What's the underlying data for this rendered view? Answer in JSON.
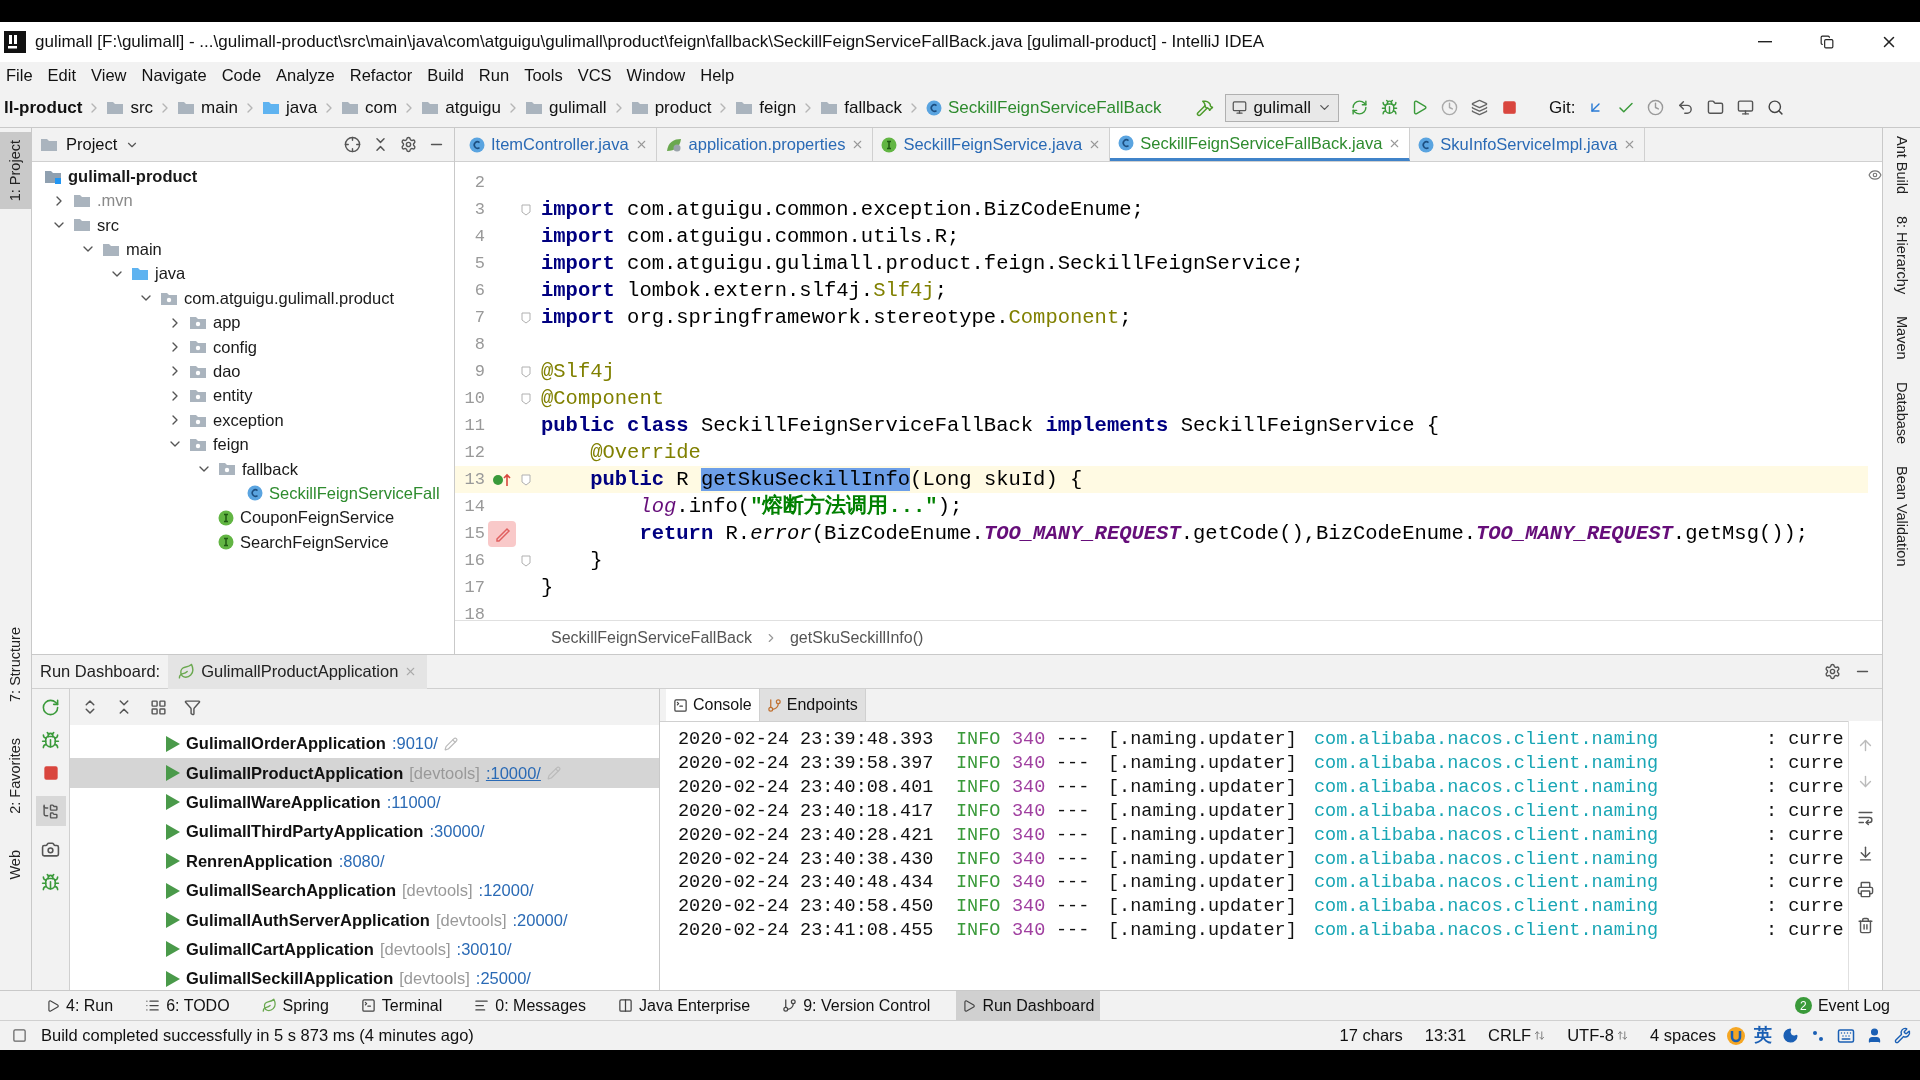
{
  "window": {
    "title": "gulimall [F:\\gulimall] - ...\\gulimall-product\\src\\main\\java\\com\\atguigu\\gulimall\\product\\feign\\fallback\\SeckillFeignServiceFallBack.java [gulimall-product] - IntelliJ IDEA"
  },
  "menu": [
    "File",
    "Edit",
    "View",
    "Navigate",
    "Code",
    "Analyze",
    "Refactor",
    "Build",
    "Run",
    "Tools",
    "VCS",
    "Window",
    "Help"
  ],
  "navigation": [
    {
      "label": "ll-product",
      "kind": "module"
    },
    {
      "label": "src",
      "kind": "folder"
    },
    {
      "label": "main",
      "kind": "folder"
    },
    {
      "label": "java",
      "kind": "source"
    },
    {
      "label": "com",
      "kind": "folder"
    },
    {
      "label": "atguigu",
      "kind": "folder"
    },
    {
      "label": "gulimall",
      "kind": "folder"
    },
    {
      "label": "product",
      "kind": "folder"
    },
    {
      "label": "feign",
      "kind": "folder"
    },
    {
      "label": "fallback",
      "kind": "folder"
    },
    {
      "label": "SeckillFeignServiceFallBack",
      "kind": "class"
    }
  ],
  "run_configuration": "gulimall",
  "git_label": "Git:",
  "left_tool_windows": [
    {
      "label": "1: Project",
      "selected": true
    },
    {
      "label": "7: Structure",
      "selected": false
    },
    {
      "label": "2: Favorites",
      "selected": false
    },
    {
      "label": "Web",
      "selected": false
    }
  ],
  "right_tool_windows": [
    "Ant Build",
    "8: Hierarchy",
    "Maven",
    "Database",
    "Bean Validation"
  ],
  "project": {
    "title": "Project",
    "tree": [
      {
        "label": "gulimall-product",
        "kind": "module",
        "children": [
          {
            "label": ".mvn",
            "kind": "excluded",
            "expanded": false
          },
          {
            "label": "src",
            "kind": "folder",
            "expanded": true,
            "children": [
              {
                "label": "main",
                "kind": "folder",
                "expanded": true,
                "children": [
                  {
                    "label": "java",
                    "kind": "source",
                    "expanded": true,
                    "children": [
                      {
                        "label": "com.atguigu.gulimall.product",
                        "kind": "package",
                        "expanded": true,
                        "children": [
                          {
                            "label": "app",
                            "kind": "package",
                            "expanded": false
                          },
                          {
                            "label": "config",
                            "kind": "package",
                            "expanded": false
                          },
                          {
                            "label": "dao",
                            "kind": "package",
                            "expanded": false
                          },
                          {
                            "label": "entity",
                            "kind": "package",
                            "expanded": false
                          },
                          {
                            "label": "exception",
                            "kind": "package",
                            "expanded": false
                          },
                          {
                            "label": "feign",
                            "kind": "package",
                            "expanded": true,
                            "children": [
                              {
                                "label": "fallback",
                                "kind": "package",
                                "expanded": true,
                                "children": [
                                  {
                                    "label": "SeckillFeignServiceFall",
                                    "kind": "class"
                                  }
                                ]
                              },
                              {
                                "label": "CouponFeignService",
                                "kind": "interface"
                              },
                              {
                                "label": "SearchFeignService",
                                "kind": "interface"
                              }
                            ]
                          }
                        ]
                      }
                    ]
                  }
                ]
              }
            ]
          }
        ]
      }
    ]
  },
  "editor_tabs": [
    {
      "label": "ItemController.java",
      "kind": "class",
      "selected": false
    },
    {
      "label": "application.properties",
      "kind": "properties",
      "selected": false
    },
    {
      "label": "SeckillFeignService.java",
      "kind": "interface",
      "selected": false
    },
    {
      "label": "SeckillFeignServiceFallBack.java",
      "kind": "class",
      "selected": true
    },
    {
      "label": "SkuInfoServiceImpl.java",
      "kind": "class",
      "selected": false
    }
  ],
  "code": [
    {
      "number": "2",
      "current": false
    },
    {
      "number": "3",
      "current": false,
      "fold": true,
      "segments": [
        {
          "text": "import",
          "kind": "keyword"
        },
        {
          "text": " com.atguigu.common.exception.BizCodeEnume;",
          "kind": "plain"
        }
      ]
    },
    {
      "number": "4",
      "current": false,
      "segments": [
        {
          "text": "import",
          "kind": "keyword"
        },
        {
          "text": " com.atguigu.common.utils.R;",
          "kind": "plain"
        }
      ]
    },
    {
      "number": "5",
      "current": false,
      "segments": [
        {
          "text": "import",
          "kind": "keyword"
        },
        {
          "text": " com.atguigu.gulimall.product.feign.SeckillFeignService;",
          "kind": "plain"
        }
      ]
    },
    {
      "number": "6",
      "current": false,
      "segments": [
        {
          "text": "import",
          "kind": "keyword"
        },
        {
          "text": " lombok.extern.slf4j.",
          "kind": "plain"
        },
        {
          "text": "Slf4j",
          "kind": "annotation"
        },
        {
          "text": ";",
          "kind": "plain"
        }
      ]
    },
    {
      "number": "7",
      "current": false,
      "fold": true,
      "segments": [
        {
          "text": "import",
          "kind": "keyword"
        },
        {
          "text": " org.springframework.stereotype.",
          "kind": "plain"
        },
        {
          "text": "Component",
          "kind": "annotation"
        },
        {
          "text": ";",
          "kind": "plain"
        }
      ]
    },
    {
      "number": "8",
      "current": false
    },
    {
      "number": "9",
      "current": false,
      "fold": true,
      "segments": [
        {
          "text": "@Slf4j",
          "kind": "annotation"
        }
      ]
    },
    {
      "number": "10",
      "current": false,
      "fold": true,
      "segments": [
        {
          "text": "@Component",
          "kind": "annotation"
        }
      ]
    },
    {
      "number": "11",
      "current": false,
      "segments": [
        {
          "text": "public class",
          "kind": "keyword"
        },
        {
          "text": " SeckillFeignServiceFallBack ",
          "kind": "plain"
        },
        {
          "text": "implements",
          "kind": "keyword"
        },
        {
          "text": " SeckillFeignService {",
          "kind": "plain"
        }
      ]
    },
    {
      "number": "12",
      "current": false,
      "segments": [
        {
          "text": "    @Override",
          "kind": "annotation"
        }
      ]
    },
    {
      "number": "13",
      "current": true,
      "fold": true,
      "gutter": {
        "kind": "implements"
      },
      "segments": [
        {
          "text": "    public",
          "kind": "keyword"
        },
        {
          "text": " R ",
          "kind": "plain"
        },
        {
          "text": "getSkuSeckillInfo",
          "kind": "selection"
        },
        {
          "text": "(Long skuId) {",
          "kind": "plain"
        }
      ]
    },
    {
      "number": "14",
      "current": false,
      "segments": [
        {
          "text": "        log",
          "kind": "field"
        },
        {
          "text": ".info(",
          "kind": "plain"
        },
        {
          "text": "\"熔断方法调用...\"",
          "kind": "string"
        },
        {
          "text": ");",
          "kind": "plain"
        }
      ]
    },
    {
      "number": "15",
      "current": false,
      "gutter": {
        "kind": "intention"
      },
      "segments": [
        {
          "text": "        return",
          "kind": "keyword"
        },
        {
          "text": " R.",
          "kind": "plain"
        },
        {
          "text": "error",
          "kind": "static-method"
        },
        {
          "text": "(BizCodeEnume.",
          "kind": "plain"
        },
        {
          "text": "TOO_MANY_REQUEST",
          "kind": "constant"
        },
        {
          "text": ".getCode(),BizCodeEnume.",
          "kind": "plain"
        },
        {
          "text": "TOO_MANY_REQUEST",
          "kind": "constant"
        },
        {
          "text": ".getMsg());",
          "kind": "plain"
        }
      ]
    },
    {
      "number": "16",
      "current": false,
      "fold": true,
      "segments": [
        {
          "text": "    }",
          "kind": "plain"
        }
      ]
    },
    {
      "number": "17",
      "current": false,
      "segments": [
        {
          "text": "}",
          "kind": "plain"
        }
      ]
    },
    {
      "number": "18",
      "current": false
    }
  ],
  "editor_breadcrumb": [
    "SeckillFeignServiceFallBack",
    "getSkuSeckillInfo()"
  ],
  "run_dashboard": {
    "title": "Run Dashboard:",
    "tab": "GulimallProductApplication",
    "applications": [
      {
        "name": "GulimallOrderApplication",
        "port": ":9010/",
        "selected": false,
        "editable": true
      },
      {
        "name": "GulimallProductApplication",
        "tag": "[devtools]",
        "port": ":10000/",
        "selected": true,
        "editable": true
      },
      {
        "name": "GulimallWareApplication",
        "port": ":11000/",
        "selected": false,
        "editable": false
      },
      {
        "name": "GulimallThirdPartyApplication",
        "port": ":30000/",
        "selected": false,
        "editable": false
      },
      {
        "name": "RenrenApplication",
        "port": ":8080/",
        "selected": false,
        "editable": false
      },
      {
        "name": "GulimallSearchApplication",
        "tag": "[devtools]",
        "port": ":12000/",
        "selected": false,
        "editable": false
      },
      {
        "name": "GulimallAuthServerApplication",
        "tag": "[devtools]",
        "port": ":20000/",
        "selected": false,
        "editable": false
      },
      {
        "name": "GulimallCartApplication",
        "tag": "[devtools]",
        "port": ":30010/",
        "selected": false,
        "editable": false
      },
      {
        "name": "GulimallSeckillApplication",
        "tag": "[devtools]",
        "port": ":25000/",
        "selected": false,
        "editable": false
      }
    ],
    "console_tabs": [
      {
        "label": "Console",
        "selected": true
      },
      {
        "label": "Endpoints",
        "selected": false
      }
    ],
    "log": [
      {
        "timestamp": "2020-02-24 23:39:48.393",
        "level": "INFO",
        "pid": "340",
        "separator": "---",
        "thread": "[.naming.updater]",
        "logger": "com.alibaba.nacos.client.naming",
        "message": ": curre"
      },
      {
        "timestamp": "2020-02-24 23:39:58.397",
        "level": "INFO",
        "pid": "340",
        "separator": "---",
        "thread": "[.naming.updater]",
        "logger": "com.alibaba.nacos.client.naming",
        "message": ": curre"
      },
      {
        "timestamp": "2020-02-24 23:40:08.401",
        "level": "INFO",
        "pid": "340",
        "separator": "---",
        "thread": "[.naming.updater]",
        "logger": "com.alibaba.nacos.client.naming",
        "message": ": curre"
      },
      {
        "timestamp": "2020-02-24 23:40:18.417",
        "level": "INFO",
        "pid": "340",
        "separator": "---",
        "thread": "[.naming.updater]",
        "logger": "com.alibaba.nacos.client.naming",
        "message": ": curre"
      },
      {
        "timestamp": "2020-02-24 23:40:28.421",
        "level": "INFO",
        "pid": "340",
        "separator": "---",
        "thread": "[.naming.updater]",
        "logger": "com.alibaba.nacos.client.naming",
        "message": ": curre"
      },
      {
        "timestamp": "2020-02-24 23:40:38.430",
        "level": "INFO",
        "pid": "340",
        "separator": "---",
        "thread": "[.naming.updater]",
        "logger": "com.alibaba.nacos.client.naming",
        "message": ": curre"
      },
      {
        "timestamp": "2020-02-24 23:40:48.434",
        "level": "INFO",
        "pid": "340",
        "separator": "---",
        "thread": "[.naming.updater]",
        "logger": "com.alibaba.nacos.client.naming",
        "message": ": curre"
      },
      {
        "timestamp": "2020-02-24 23:40:58.450",
        "level": "INFO",
        "pid": "340",
        "separator": "---",
        "thread": "[.naming.updater]",
        "logger": "com.alibaba.nacos.client.naming",
        "message": ": curre"
      },
      {
        "timestamp": "2020-02-24 23:41:08.455",
        "level": "INFO",
        "pid": "340",
        "separator": "---",
        "thread": "[.naming.updater]",
        "logger": "com.alibaba.nacos.client.naming",
        "message": ": curre"
      }
    ]
  },
  "tool_windows": [
    {
      "label": "4: Run",
      "kind": "run",
      "selected": false
    },
    {
      "label": "6: TODO",
      "kind": "todo",
      "selected": false
    },
    {
      "label": "Spring",
      "kind": "spring",
      "selected": false
    },
    {
      "label": "Terminal",
      "kind": "terminal",
      "selected": false
    },
    {
      "label": "0: Messages",
      "kind": "messages",
      "selected": false
    },
    {
      "label": "Java Enterprise",
      "kind": "enterprise",
      "selected": false
    },
    {
      "label": "9: Version Control",
      "kind": "vcs",
      "selected": false
    },
    {
      "label": "Run Dashboard",
      "kind": "run",
      "selected": true
    }
  ],
  "event_log": {
    "label": "Event Log",
    "count": "2"
  },
  "status_bar": {
    "message": "Build completed successfully in 5 s 873 ms (4 minutes ago)",
    "items": [
      "17 chars",
      "13:31",
      "CRLF",
      "UTF-8",
      "4 spaces"
    ],
    "input_method": "英"
  }
}
